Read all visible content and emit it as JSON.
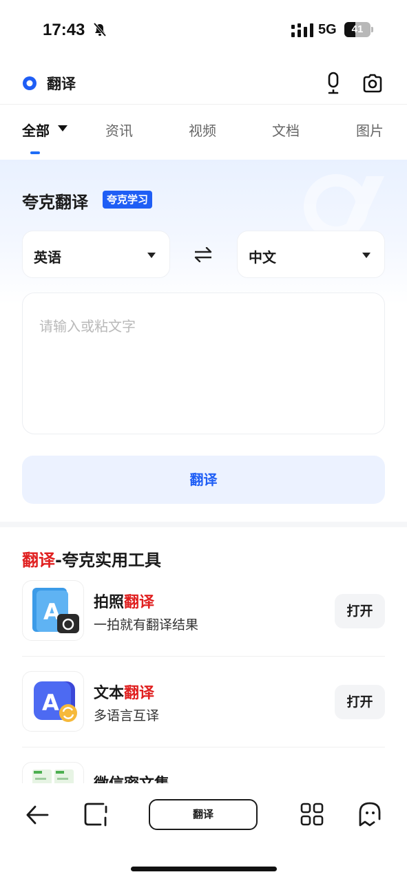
{
  "status_bar": {
    "time": "17:43",
    "network": "5G",
    "battery": "41",
    "battery_fraction": 0.41
  },
  "search": {
    "query": "翻译"
  },
  "tabs": [
    {
      "label": "全部",
      "active": true
    },
    {
      "label": "资讯"
    },
    {
      "label": "视频"
    },
    {
      "label": "文档"
    },
    {
      "label": "图片"
    }
  ],
  "translator": {
    "title": "夸克翻译",
    "badge": "夸克学习",
    "source_lang": "英语",
    "target_lang": "中文",
    "placeholder": "请输入或粘文字",
    "button_label": "翻译"
  },
  "tools": {
    "title_highlight": "翻译",
    "title_rest": "-夸克实用工具",
    "items": [
      {
        "name_prefix": "拍照",
        "name_highlight": "翻译",
        "desc": "一拍就有翻译结果",
        "action": "打开"
      },
      {
        "name_prefix": "文本",
        "name_highlight": "翻译",
        "desc": "多语言互译",
        "action": "打开"
      },
      {
        "name_prefix": "微信密文集",
        "name_highlight": "",
        "desc": "",
        "action": ""
      }
    ]
  },
  "bottom_nav": {
    "pill_label": "翻译"
  },
  "colors": {
    "accent_blue": "#1f5ef5",
    "highlight_red": "#e02020"
  }
}
